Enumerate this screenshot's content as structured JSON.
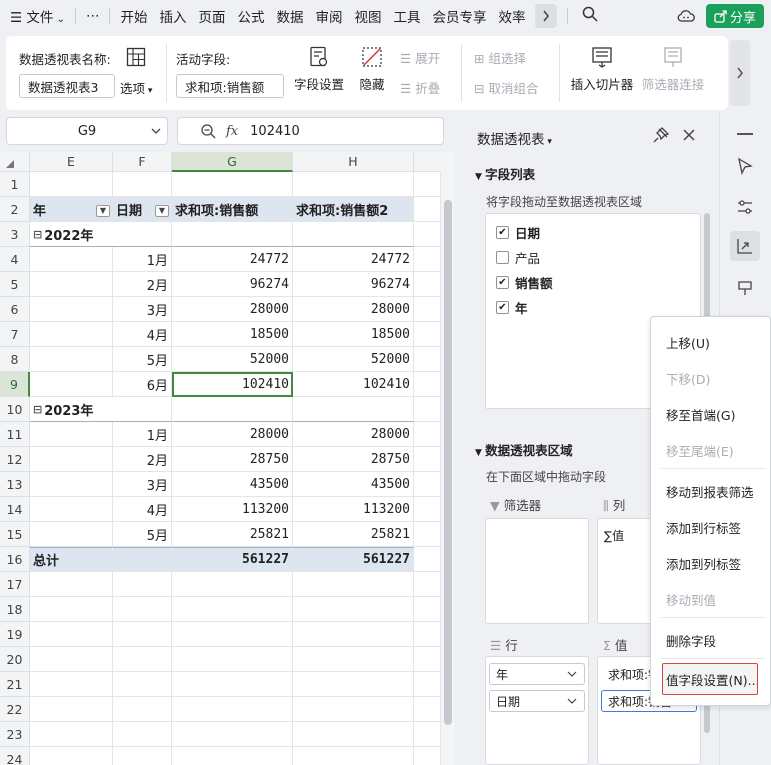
{
  "menubar": {
    "file": "文件",
    "more": "⋯",
    "tabs": [
      "开始",
      "插入",
      "页面",
      "公式",
      "数据",
      "审阅",
      "视图",
      "工具",
      "会员专享",
      "效率"
    ],
    "share": "分享"
  },
  "ribbon": {
    "pivot_name_label": "数据透视表名称:",
    "pivot_name_value": "数据透视表3",
    "options_label": "选项",
    "active_field_label": "活动字段:",
    "active_field_value": "求和项:销售额",
    "field_settings": "字段设置",
    "hide": "隐藏",
    "expand": "展开",
    "collapse": "折叠",
    "group_select": "组选择",
    "ungroup": "取消组合",
    "insert_slicer": "插入切片器",
    "filter_connect": "筛选器连接"
  },
  "formula_bar": {
    "name_box": "G9",
    "fx": "fx",
    "value": "102410"
  },
  "grid": {
    "columns": [
      "E",
      "F",
      "G",
      "H"
    ],
    "row_numbers": [
      "1",
      "2",
      "3",
      "4",
      "5",
      "6",
      "7",
      "8",
      "9",
      "10",
      "11",
      "12",
      "13",
      "14",
      "15",
      "16",
      "17",
      "18",
      "19",
      "20",
      "21",
      "22",
      "23",
      "24"
    ],
    "header_row": {
      "year": "年",
      "date": "日期",
      "sum1": "求和项:销售额",
      "sum2": "求和项:销售额2"
    },
    "group_2022": "2022年",
    "rows_2022": [
      {
        "month": "1月",
        "v1": "24772",
        "v2": "24772"
      },
      {
        "month": "2月",
        "v1": "96274",
        "v2": "96274"
      },
      {
        "month": "3月",
        "v1": "28000",
        "v2": "28000"
      },
      {
        "month": "4月",
        "v1": "18500",
        "v2": "18500"
      },
      {
        "month": "5月",
        "v1": "52000",
        "v2": "52000"
      },
      {
        "month": "6月",
        "v1": "102410",
        "v2": "102410"
      }
    ],
    "group_2023": "2023年",
    "rows_2023": [
      {
        "month": "1月",
        "v1": "28000",
        "v2": "28000"
      },
      {
        "month": "2月",
        "v1": "28750",
        "v2": "28750"
      },
      {
        "month": "3月",
        "v1": "43500",
        "v2": "43500"
      },
      {
        "month": "4月",
        "v1": "113200",
        "v2": "113200"
      },
      {
        "month": "5月",
        "v1": "25821",
        "v2": "25821"
      }
    ],
    "total_label": "总计",
    "total_v1": "561227",
    "total_v2": "561227"
  },
  "pane": {
    "title": "数据透视表",
    "field_list_title": "字段列表",
    "drag_hint": "将字段拖动至数据透视表区域",
    "fields": [
      {
        "name": "日期",
        "checked": true
      },
      {
        "name": "产品",
        "checked": false
      },
      {
        "name": "销售额",
        "checked": true
      },
      {
        "name": "年",
        "checked": true
      }
    ],
    "areas_title": "数据透视表区域",
    "areas_hint": "在下面区域中拖动字段",
    "filter_label": "筛选器",
    "column_label": "列",
    "column_item": "∑值",
    "row_label": "行",
    "value_label": "值",
    "row_items": [
      "年",
      "日期"
    ],
    "value_items": [
      "求和项:销售额",
      "求和项:销售..."
    ]
  },
  "context_menu": {
    "items": [
      "上移(U)",
      "下移(D)",
      "移至首端(G)",
      "移至尾端(E)",
      "移动到报表筛选",
      "添加到行标签",
      "添加到列标签",
      "移动到值",
      "删除字段",
      "值字段设置(N)..."
    ]
  }
}
